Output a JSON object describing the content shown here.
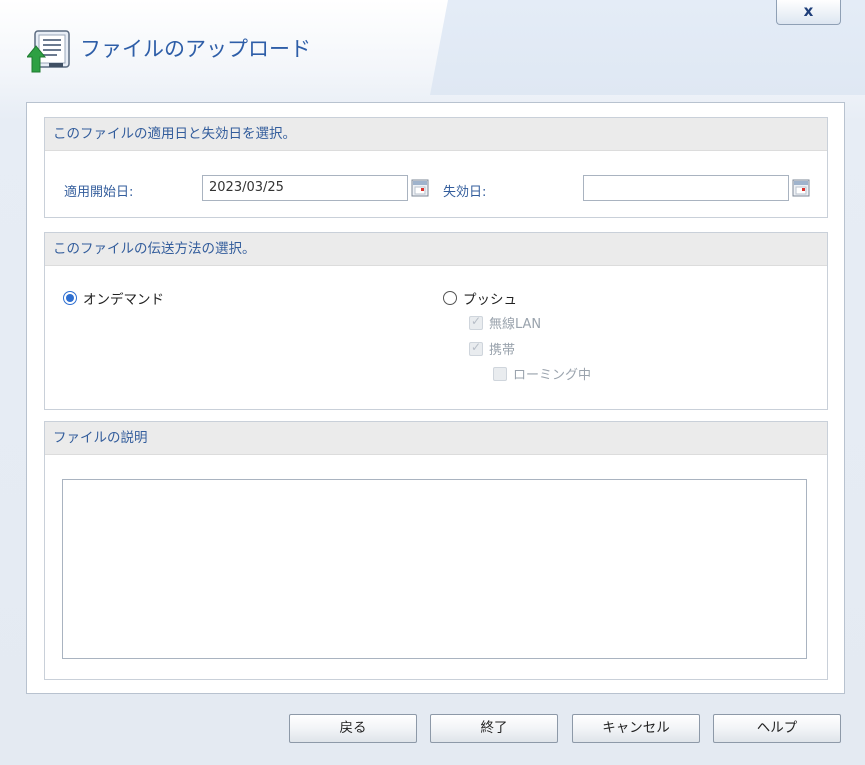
{
  "window": {
    "title": "ファイルのアップロード",
    "close_label": "x"
  },
  "validity": {
    "heading": "このファイルの適用日と失効日を選択。",
    "start_label": "適用開始日:",
    "start_value": "2023/03/25",
    "expiry_label": "失効日:",
    "expiry_value": ""
  },
  "delivery": {
    "heading": "このファイルの伝送方法の選択。",
    "on_demand_label": "オンデマンド",
    "on_demand_selected": true,
    "push_label": "プッシュ",
    "push_selected": false,
    "wireless_lan_label": "無線LAN",
    "wireless_lan_checked": true,
    "mobile_label": "携帯",
    "mobile_checked": true,
    "roaming_label": "ローミング中",
    "roaming_checked": false
  },
  "description": {
    "heading": "ファイルの説明",
    "value": ""
  },
  "buttons": {
    "back": "戻る",
    "finish": "終了",
    "cancel": "キャンセル",
    "help": "ヘルプ"
  },
  "colors": {
    "accent": "#2e5ea8",
    "section_heading": "#335d9c",
    "radio_selected": "#2e6fd1"
  }
}
